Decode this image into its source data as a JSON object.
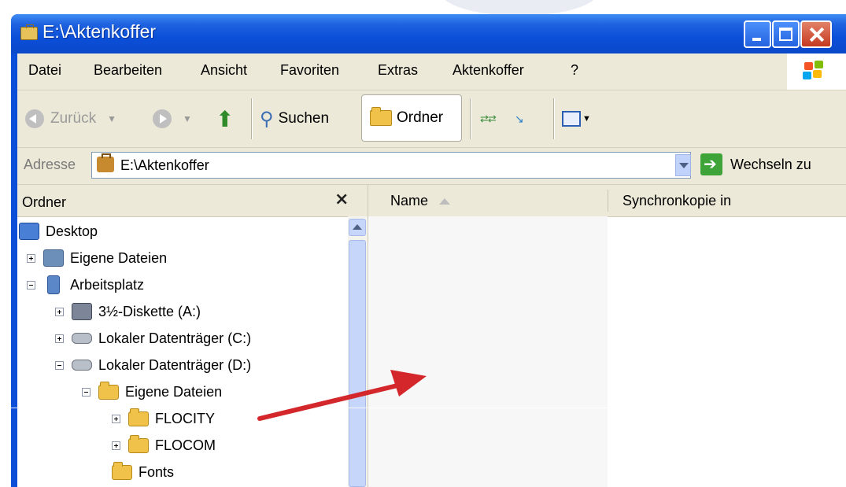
{
  "window": {
    "title": "E:\\Aktenkoffer"
  },
  "menu": {
    "items": [
      "Datei",
      "Bearbeiten",
      "Ansicht",
      "Favoriten",
      "Extras",
      "Aktenkoffer",
      "?"
    ]
  },
  "toolbar": {
    "back_label": "Zurück",
    "search_label": "Suchen",
    "folders_label": "Ordner"
  },
  "address": {
    "label": "Adresse",
    "value": "E:\\Aktenkoffer",
    "go_label": "Wechseln zu"
  },
  "folder_pane": {
    "title": "Ordner",
    "close_glyph": "×",
    "tree": [
      {
        "label": "Desktop",
        "icon": "desktop-icon",
        "expander": "none"
      },
      {
        "label": "Eigene Dateien",
        "icon": "documents-icon",
        "expander": "plus"
      },
      {
        "label": "Arbeitsplatz",
        "icon": "computer-icon",
        "expander": "minus"
      },
      {
        "label": "3½-Diskette (A:)",
        "icon": "floppy-icon",
        "expander": "plus"
      },
      {
        "label": "Lokaler Datenträger (C:)",
        "icon": "hard-drive-icon",
        "expander": "plus"
      },
      {
        "label": "Lokaler Datenträger (D:)",
        "icon": "hard-drive-icon",
        "expander": "minus"
      },
      {
        "label": "Eigene Dateien",
        "icon": "folder-icon",
        "expander": "minus"
      },
      {
        "label": "FLOCITY",
        "icon": "folder-icon",
        "expander": "plus"
      },
      {
        "label": "FLOCOM",
        "icon": "folder-icon",
        "expander": "plus"
      },
      {
        "label": "Fonts",
        "icon": "folder-icon",
        "expander": "none"
      }
    ]
  },
  "file_pane": {
    "columns": [
      "Name",
      "Synchronkopie in"
    ]
  },
  "colors": {
    "titlebar": "#0b4fd8",
    "chrome": "#ece9d8",
    "annotation_arrow": "#d3272b"
  }
}
